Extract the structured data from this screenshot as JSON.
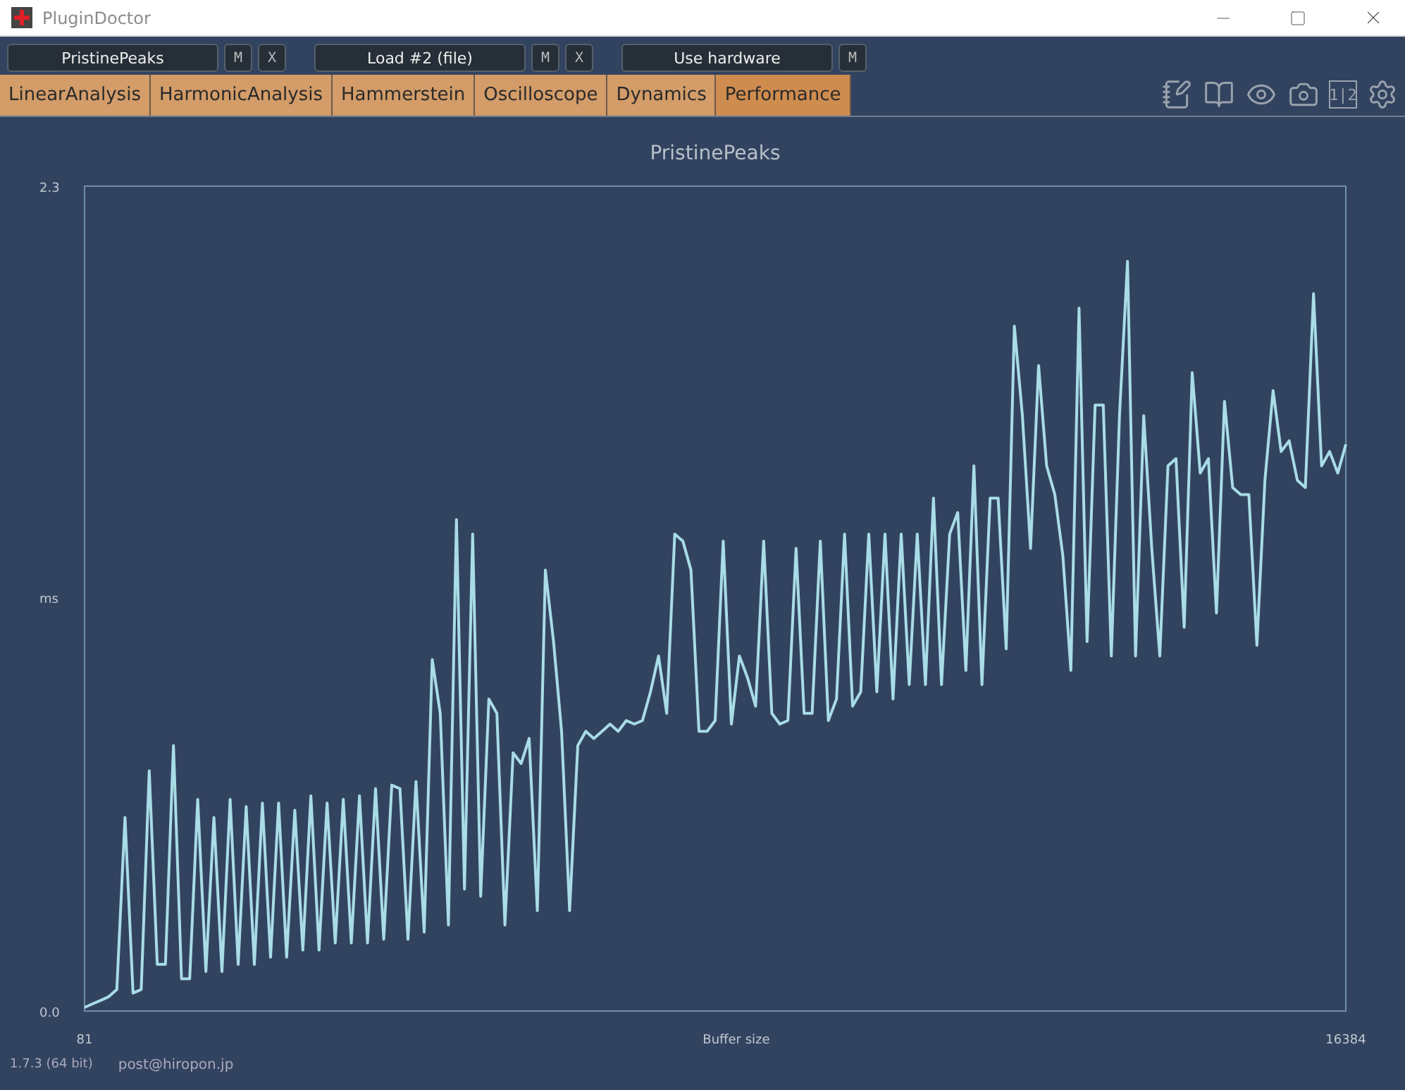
{
  "window": {
    "title": "PluginDoctor"
  },
  "slots": [
    {
      "label": "PristinePeaks",
      "buttons": [
        "M",
        "X"
      ]
    },
    {
      "label": "Load #2 (file)",
      "buttons": [
        "M",
        "X"
      ]
    },
    {
      "label": "Use hardware",
      "buttons": [
        "M"
      ]
    }
  ],
  "tabs": [
    {
      "label": "LinearAnalysis",
      "selected": false
    },
    {
      "label": "HarmonicAnalysis",
      "selected": false
    },
    {
      "label": "Hammerstein",
      "selected": false
    },
    {
      "label": "Oscilloscope",
      "selected": false
    },
    {
      "label": "Dynamics",
      "selected": false
    },
    {
      "label": "Performance",
      "selected": true
    }
  ],
  "toolbar": [
    {
      "kind": "notes"
    },
    {
      "kind": "book"
    },
    {
      "kind": "eye"
    },
    {
      "kind": "camera"
    },
    {
      "kind": "text",
      "text": "1|2"
    },
    {
      "kind": "settings"
    }
  ],
  "chart": {
    "chart_data": {
      "type": "line",
      "title": "PristinePeaks",
      "xlabel": "Buffer size",
      "ylabel": "ms",
      "ylim": [
        0,
        2.3
      ],
      "yticks": [
        {
          "value": 0,
          "label": "0.0"
        },
        {
          "value": 2.3,
          "label": "2.3"
        }
      ],
      "series": [
        {
          "color": "#a8dce6",
          "values": [
            0.01,
            0.02,
            0.03,
            0.04,
            0.06,
            0.54,
            0.05,
            0.06,
            0.67,
            0.13,
            0.13,
            0.74,
            0.09,
            0.09,
            0.59,
            0.11,
            0.54,
            0.11,
            0.59,
            0.13,
            0.57,
            0.13,
            0.58,
            0.15,
            0.58,
            0.15,
            0.56,
            0.17,
            0.6,
            0.17,
            0.58,
            0.19,
            0.59,
            0.19,
            0.6,
            0.19,
            0.62,
            0.2,
            0.63,
            0.62,
            0.2,
            0.64,
            0.22,
            0.98,
            0.83,
            0.24,
            1.37,
            0.34,
            1.33,
            0.32,
            0.87,
            0.83,
            0.24,
            0.72,
            0.69,
            0.76,
            0.28,
            1.23,
            1.03,
            0.78,
            0.28,
            0.74,
            0.78,
            0.76,
            0.78,
            0.8,
            0.78,
            0.81,
            0.8,
            0.81,
            0.89,
            0.99,
            0.83,
            1.33,
            1.31,
            1.23,
            0.78,
            0.78,
            0.81,
            1.31,
            0.8,
            0.99,
            0.93,
            0.85,
            1.31,
            0.83,
            0.8,
            0.81,
            1.29,
            0.83,
            0.83,
            1.31,
            0.81,
            0.87,
            1.33,
            0.85,
            0.89,
            1.33,
            0.89,
            1.33,
            0.87,
            1.33,
            0.91,
            1.33,
            0.91,
            1.43,
            0.91,
            1.33,
            1.39,
            0.95,
            1.52,
            0.91,
            1.43,
            1.43,
            1.01,
            1.91,
            1.66,
            1.29,
            1.8,
            1.52,
            1.44,
            1.27,
            0.95,
            1.96,
            1.03,
            1.69,
            1.69,
            0.99,
            1.66,
            2.09,
            0.99,
            1.66,
            1.29,
            0.99,
            1.52,
            1.54,
            1.07,
            1.78,
            1.5,
            1.54,
            1.11,
            1.7,
            1.46,
            1.44,
            1.44,
            1.02,
            1.48,
            1.73,
            1.56,
            1.59,
            1.48,
            1.46,
            2.0,
            1.52,
            1.56,
            1.5,
            1.58
          ]
        }
      ]
    },
    "x_tick_labels": [
      "81",
      "16384"
    ]
  },
  "status_bar": {
    "version": "1.7.3 (64 bit)",
    "contact": "post@hiropon.jp"
  }
}
